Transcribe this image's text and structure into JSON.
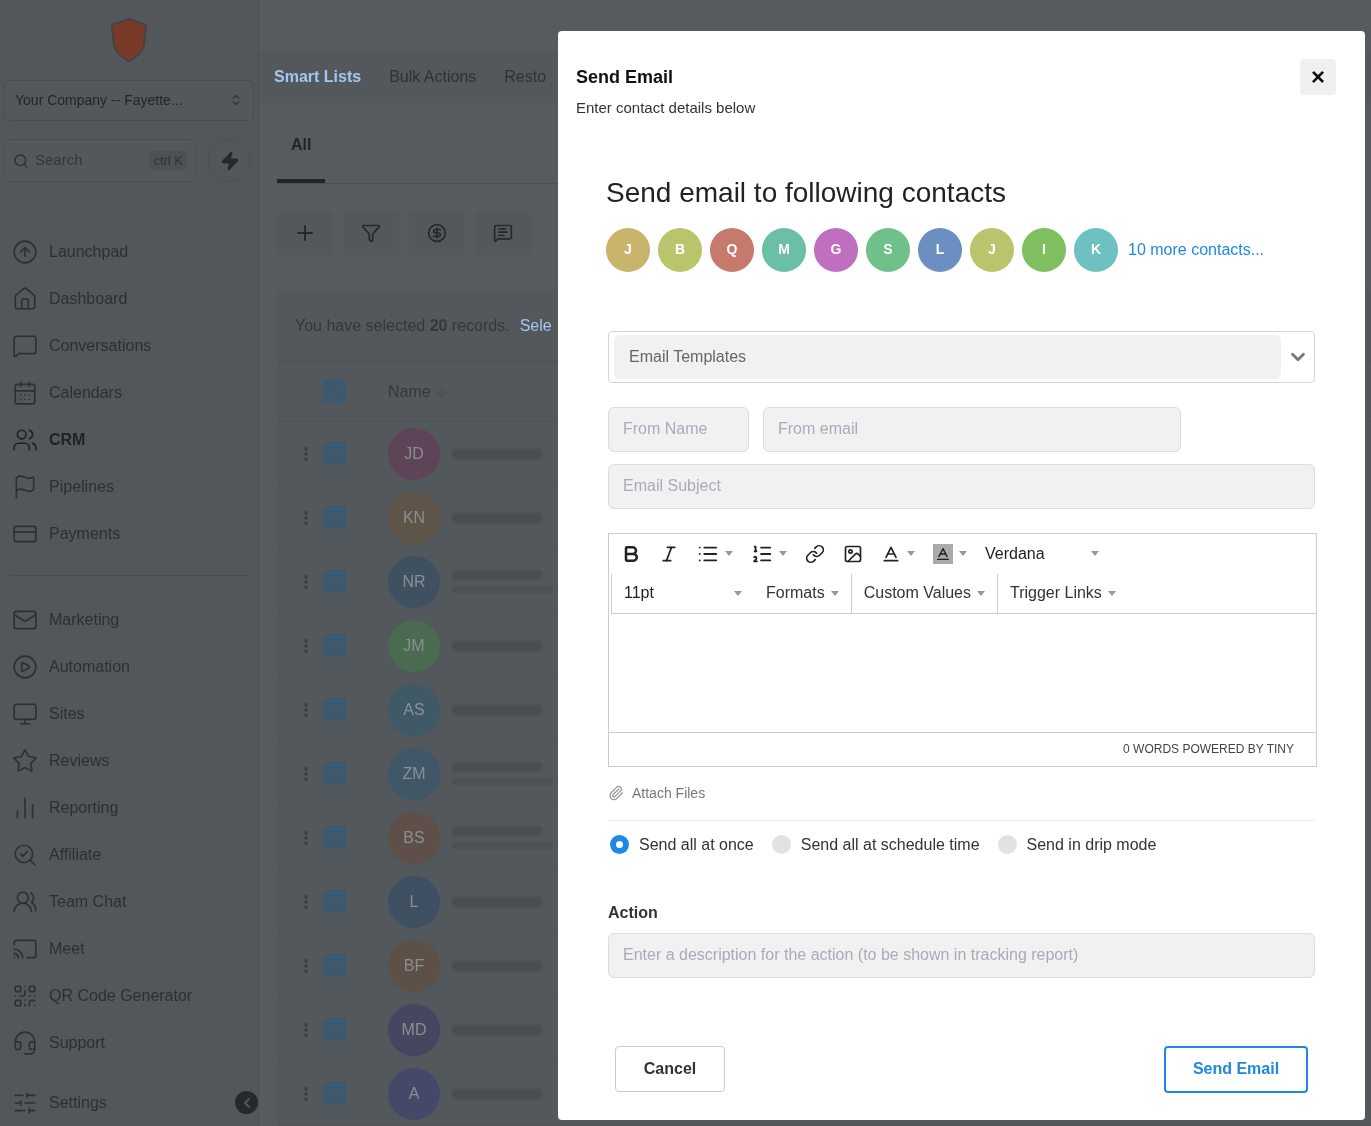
{
  "sidebar": {
    "company": "Your Company -- Fayette...",
    "search": {
      "placeholder": "Search",
      "shortcut": "ctrl K"
    },
    "groups": [
      [
        {
          "label": "Launchpad",
          "selected": false
        },
        {
          "label": "Dashboard",
          "selected": false
        },
        {
          "label": "Conversations",
          "selected": false
        },
        {
          "label": "Calendars",
          "selected": false
        },
        {
          "label": "CRM",
          "selected": true
        },
        {
          "label": "Pipelines",
          "selected": false
        },
        {
          "label": "Payments",
          "selected": false
        }
      ],
      [
        {
          "label": "Marketing",
          "selected": false
        },
        {
          "label": "Automation",
          "selected": false
        },
        {
          "label": "Sites",
          "selected": false
        },
        {
          "label": "Reviews",
          "selected": false
        },
        {
          "label": "Reporting",
          "selected": false
        },
        {
          "label": "Affiliate",
          "selected": false
        },
        {
          "label": "Team Chat",
          "selected": false
        },
        {
          "label": "Meet",
          "selected": false
        },
        {
          "label": "QR Code Generator",
          "selected": false
        },
        {
          "label": "Support",
          "selected": false
        },
        {
          "label": "Settings",
          "selected": false
        }
      ]
    ]
  },
  "main": {
    "top_tabs": [
      {
        "label": "Smart Lists",
        "selected": true
      },
      {
        "label": "Bulk Actions",
        "selected": false
      },
      {
        "label": "Resto",
        "selected": false
      }
    ],
    "list_tabs": [
      {
        "label": "All",
        "selected": true
      }
    ],
    "selection_notice": "You have selected **20** records.",
    "selection_link": "Sele",
    "table": {
      "header_checked": true,
      "name_column": "Name",
      "rows": [
        {
          "initials": "JD",
          "color": "#5e4459",
          "checked": true,
          "has_subtitle": false
        },
        {
          "initials": "KN",
          "color": "#5e5548",
          "checked": true,
          "has_subtitle": false
        },
        {
          "initials": "NR",
          "color": "#3f5160",
          "checked": true,
          "has_subtitle": true
        },
        {
          "initials": "JM",
          "color": "#4a6b50",
          "checked": true,
          "has_subtitle": false
        },
        {
          "initials": "AS",
          "color": "#3f5a66",
          "checked": true,
          "has_subtitle": false
        },
        {
          "initials": "ZM",
          "color": "#3f5766",
          "checked": true,
          "has_subtitle": true
        },
        {
          "initials": "BS",
          "color": "#5e5048",
          "checked": true,
          "has_subtitle": true
        },
        {
          "initials": "L",
          "color": "#3f4f62",
          "checked": true,
          "has_subtitle": false
        },
        {
          "initials": "BF",
          "color": "#5c5047",
          "checked": true,
          "has_subtitle": false
        },
        {
          "initials": "MD",
          "color": "#45465f",
          "checked": true,
          "has_subtitle": false
        },
        {
          "initials": "A",
          "color": "#44496a",
          "checked": true,
          "has_subtitle": false
        }
      ]
    }
  },
  "modal": {
    "title": "Send Email",
    "subtitle": "Enter contact details below",
    "close": "×",
    "heading": "Send email to following contacts",
    "contacts": [
      {
        "initials": "J",
        "color": "#c8b46a"
      },
      {
        "initials": "B",
        "color": "#b9c46c"
      },
      {
        "initials": "Q",
        "color": "#c57a6b"
      },
      {
        "initials": "M",
        "color": "#6bbfa5"
      },
      {
        "initials": "G",
        "color": "#c06fc0"
      },
      {
        "initials": "S",
        "color": "#6fc08a"
      },
      {
        "initials": "L",
        "color": "#6a8fc0"
      },
      {
        "initials": "J",
        "color": "#b9c46c"
      },
      {
        "initials": "I",
        "color": "#7fbf5f"
      },
      {
        "initials": "K",
        "color": "#6fc0c0"
      }
    ],
    "more_contacts": "10 more contacts...",
    "template_select": {
      "placeholder": "Email Templates"
    },
    "from_name": {
      "placeholder": "From Name"
    },
    "from_email": {
      "placeholder": "From email"
    },
    "subject": {
      "placeholder": "Email Subject"
    },
    "editor": {
      "font": "Verdana",
      "size": "11pt",
      "menus": [
        "Formats",
        "Custom Values",
        "Trigger Links"
      ],
      "status": "0 WORDS POWERED BY TINY"
    },
    "attach": "Attach Files",
    "send_modes": [
      {
        "label": "Send all at once",
        "selected": true
      },
      {
        "label": "Send all at schedule time",
        "selected": false
      },
      {
        "label": "Send in drip mode",
        "selected": false
      }
    ],
    "action": {
      "label": "Action",
      "placeholder": "Enter a description for the action (to be shown in tracking report)"
    },
    "buttons": {
      "cancel": "Cancel",
      "send": "Send Email"
    }
  }
}
